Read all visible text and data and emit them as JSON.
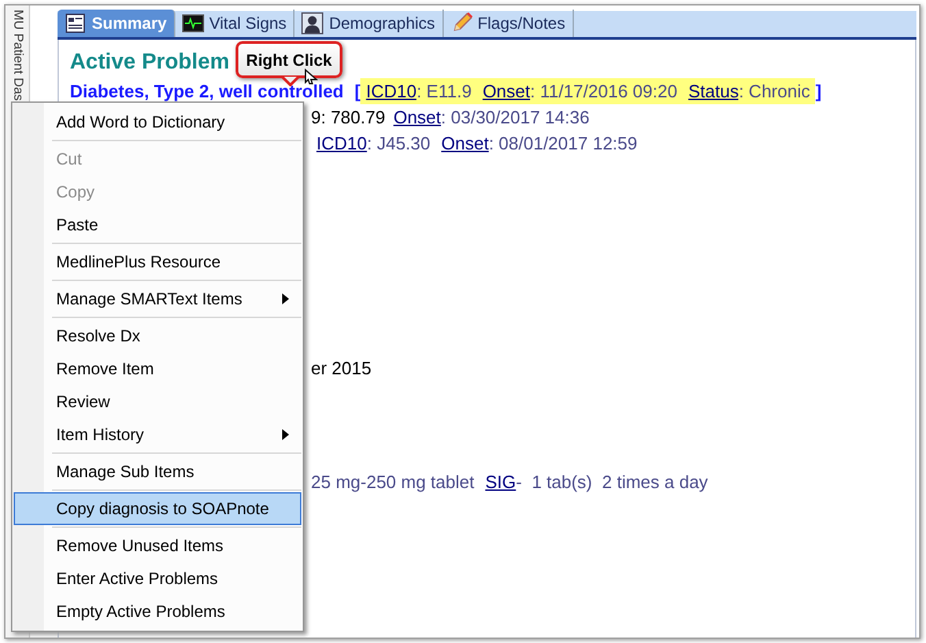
{
  "sidebar": {
    "label": "MU Patient Das"
  },
  "tabs": [
    {
      "label": "Summary",
      "selected": true
    },
    {
      "label": "Vital Signs",
      "selected": false
    },
    {
      "label": "Demographics",
      "selected": false
    },
    {
      "label": "Flags/Notes",
      "selected": false
    }
  ],
  "content": {
    "heading": "Active Problem",
    "problems": [
      {
        "parts": [
          {
            "kind": "title",
            "text": "Diabetes, Type 2, well controlled"
          },
          {
            "kind": "bracket",
            "text": "["
          },
          {
            "kind": "link",
            "text": "ICD10",
            "highlight": true
          },
          {
            "kind": "text",
            "text": ": E11.9",
            "highlight": true
          },
          {
            "kind": "link",
            "text": "Onset",
            "highlight": true
          },
          {
            "kind": "text",
            "text": ": 11/17/2016 09:20",
            "highlight": true
          },
          {
            "kind": "link",
            "text": "Status",
            "highlight": true
          },
          {
            "kind": "text",
            "text": ": Chronic",
            "highlight": true
          },
          {
            "kind": "bracket",
            "text": "]"
          }
        ]
      },
      {
        "parts": [
          {
            "kind": "plain",
            "text": "9: 780.79"
          },
          {
            "kind": "link",
            "text": "Onset"
          },
          {
            "kind": "text",
            "text": ": 03/30/2017 14:36"
          }
        ]
      },
      {
        "parts": [
          {
            "kind": "link",
            "text": "ICD10"
          },
          {
            "kind": "text",
            "text": ": J45.30"
          },
          {
            "kind": "link",
            "text": "Onset"
          },
          {
            "kind": "text",
            "text": ": 08/01/2017 12:59"
          }
        ]
      }
    ],
    "fragments": [
      {
        "parts": [
          {
            "kind": "plain",
            "text": "er 2015"
          }
        ]
      },
      {
        "parts": [
          {
            "kind": "text",
            "text": "25 mg-250 mg tablet"
          },
          {
            "kind": "link",
            "text": "SIG"
          },
          {
            "kind": "text",
            "text": "-  1 tab(s)  2 times a day"
          }
        ]
      }
    ]
  },
  "callout": {
    "text": "Right Click"
  },
  "context_menu": [
    {
      "kind": "item",
      "label": "Add Word to Dictionary",
      "disabled": false,
      "submenu": false,
      "selected": false
    },
    {
      "kind": "separator"
    },
    {
      "kind": "item",
      "label": "Cut",
      "disabled": true,
      "submenu": false,
      "selected": false
    },
    {
      "kind": "item",
      "label": "Copy",
      "disabled": true,
      "submenu": false,
      "selected": false
    },
    {
      "kind": "item",
      "label": "Paste",
      "disabled": false,
      "submenu": false,
      "selected": false
    },
    {
      "kind": "separator"
    },
    {
      "kind": "item",
      "label": "MedlinePlus Resource",
      "disabled": false,
      "submenu": false,
      "selected": false
    },
    {
      "kind": "separator"
    },
    {
      "kind": "item",
      "label": "Manage SMARText Items",
      "disabled": false,
      "submenu": true,
      "selected": false
    },
    {
      "kind": "separator"
    },
    {
      "kind": "item",
      "label": "Resolve Dx",
      "disabled": false,
      "submenu": false,
      "selected": false
    },
    {
      "kind": "item",
      "label": "Remove Item",
      "disabled": false,
      "submenu": false,
      "selected": false
    },
    {
      "kind": "item",
      "label": "Review",
      "disabled": false,
      "submenu": false,
      "selected": false
    },
    {
      "kind": "item",
      "label": "Item History",
      "disabled": false,
      "submenu": true,
      "selected": false
    },
    {
      "kind": "separator"
    },
    {
      "kind": "item",
      "label": "Manage Sub Items",
      "disabled": false,
      "submenu": false,
      "selected": false
    },
    {
      "kind": "separator"
    },
    {
      "kind": "item",
      "label": "Copy diagnosis to SOAPnote",
      "disabled": false,
      "submenu": false,
      "selected": true
    },
    {
      "kind": "separator"
    },
    {
      "kind": "item",
      "label": "Remove Unused Items",
      "disabled": false,
      "submenu": false,
      "selected": false
    },
    {
      "kind": "item",
      "label": "Enter Active Problems",
      "disabled": false,
      "submenu": false,
      "selected": false
    },
    {
      "kind": "item",
      "label": "Empty Active Problems",
      "disabled": false,
      "submenu": false,
      "selected": false
    }
  ]
}
